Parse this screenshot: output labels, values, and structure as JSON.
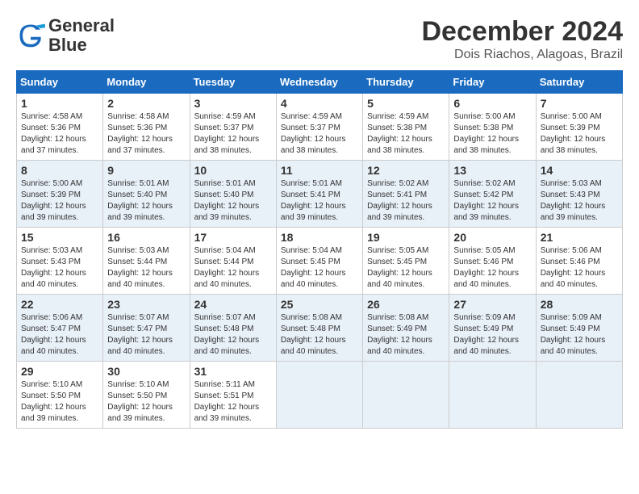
{
  "header": {
    "logo_line1": "General",
    "logo_line2": "Blue",
    "title": "December 2024",
    "subtitle": "Dois Riachos, Alagoas, Brazil"
  },
  "calendar": {
    "days_of_week": [
      "Sunday",
      "Monday",
      "Tuesday",
      "Wednesday",
      "Thursday",
      "Friday",
      "Saturday"
    ],
    "weeks": [
      [
        null,
        null,
        null,
        null,
        null,
        null,
        null
      ]
    ]
  },
  "cells": {
    "w1": [
      null,
      null,
      null,
      null,
      null,
      null,
      null
    ]
  }
}
